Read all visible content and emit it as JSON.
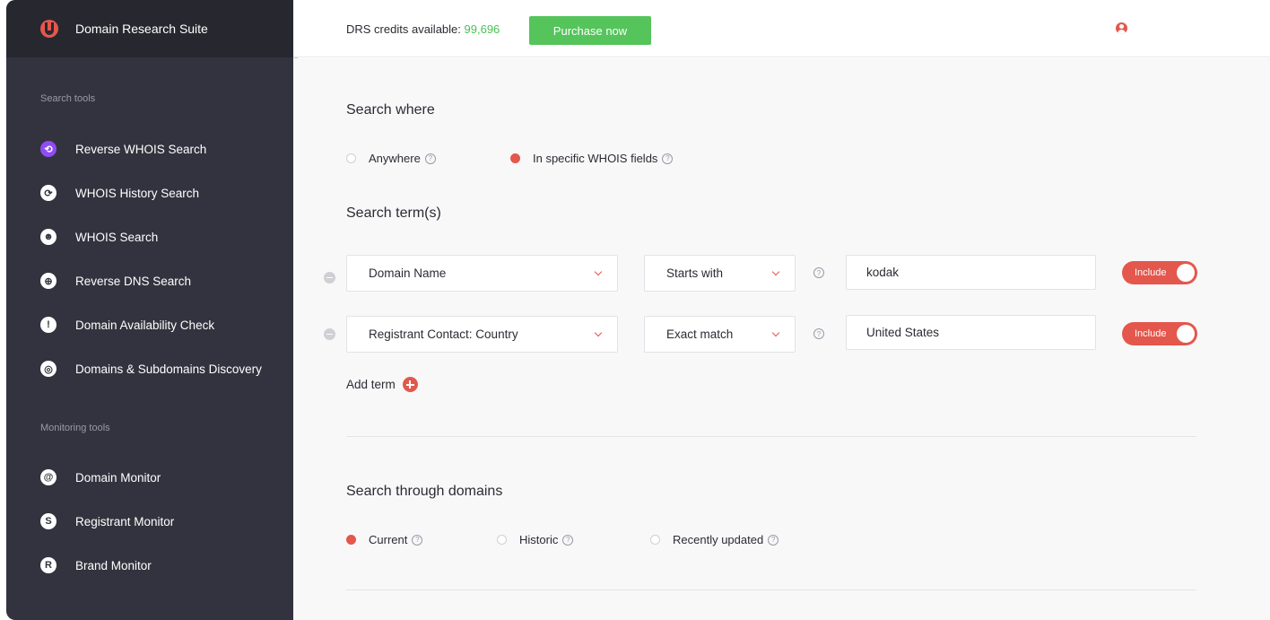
{
  "sidebar": {
    "title": "Domain Research Suite",
    "sections": [
      {
        "label": "Search tools",
        "items": [
          {
            "label": "Reverse WHOIS Search",
            "icon": "reverse-whois-icon",
            "glyph": "⟲",
            "active": true
          },
          {
            "label": "WHOIS History Search",
            "icon": "history-icon",
            "glyph": "⟳",
            "active": false
          },
          {
            "label": "WHOIS Search",
            "icon": "user-search-icon",
            "glyph": "☻",
            "active": false
          },
          {
            "label": "Reverse DNS Search",
            "icon": "globe-icon",
            "glyph": "⊕",
            "active": false
          },
          {
            "label": "Domain Availability Check",
            "icon": "exclamation-icon",
            "glyph": "!",
            "active": false
          },
          {
            "label": "Domains & Subdomains Discovery",
            "icon": "target-icon",
            "glyph": "◎",
            "active": false
          }
        ]
      },
      {
        "label": "Monitoring tools",
        "items": [
          {
            "label": "Domain Monitor",
            "icon": "domain-monitor-icon",
            "glyph": "@",
            "active": false
          },
          {
            "label": "Registrant Monitor",
            "icon": "registrant-icon",
            "glyph": "S",
            "active": false
          },
          {
            "label": "Brand Monitor",
            "icon": "brand-icon",
            "glyph": "R",
            "active": false
          }
        ]
      }
    ]
  },
  "topbar": {
    "credits_label": "DRS credits available:",
    "credits_value": "99,696",
    "purchase_label": "Purchase now"
  },
  "search_where": {
    "heading": "Search where",
    "options": [
      {
        "label": "Anywhere",
        "selected": false
      },
      {
        "label": "In specific WHOIS fields",
        "selected": true
      }
    ]
  },
  "search_terms": {
    "heading": "Search term(s)",
    "rows": [
      {
        "field": "Domain Name",
        "match": "Starts with",
        "value": "kodak",
        "toggle": "Include"
      },
      {
        "field": "Registrant Contact: Country",
        "match": "Exact match",
        "value": "United States",
        "toggle": "Include"
      }
    ],
    "add_label": "Add term"
  },
  "search_through": {
    "heading": "Search through domains",
    "options": [
      {
        "label": "Current",
        "selected": true
      },
      {
        "label": "Historic",
        "selected": false
      },
      {
        "label": "Recently updated",
        "selected": false
      }
    ]
  },
  "colors": {
    "accent": "#e4574c",
    "green": "#54c45b",
    "sidebar": "#33333f",
    "active_icon": "#8f4cf5"
  }
}
